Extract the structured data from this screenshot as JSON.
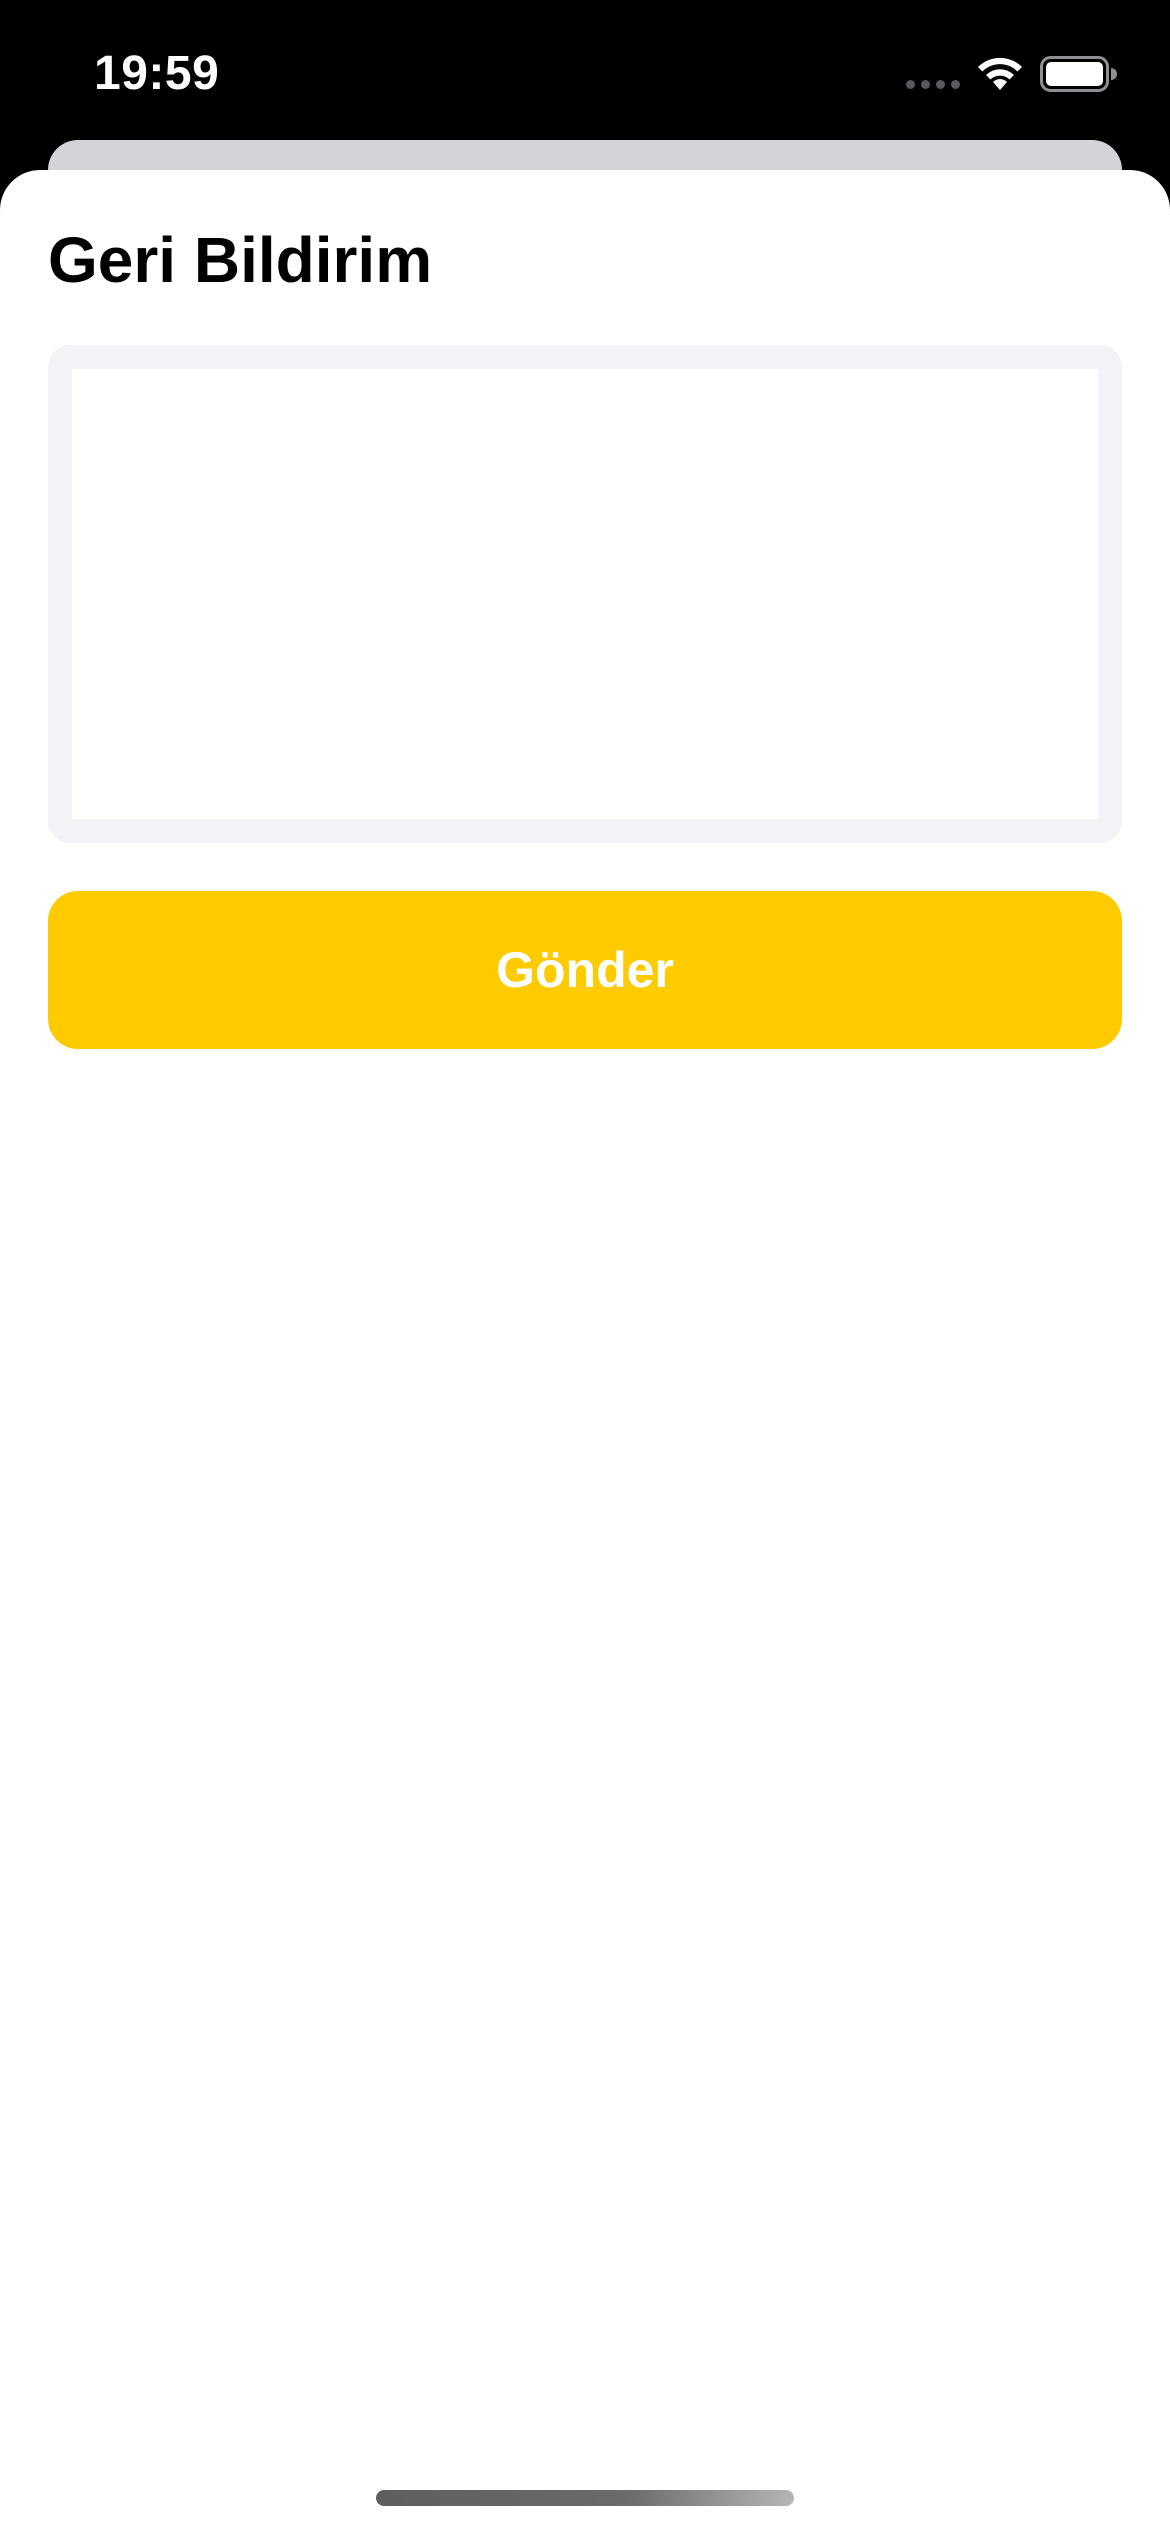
{
  "status_bar": {
    "time": "19:59",
    "icons": [
      "cellular-signal-icon",
      "wifi-icon",
      "battery-icon"
    ]
  },
  "sheet": {
    "title": "Geri Bildirim",
    "feedback_input": {
      "value": "",
      "placeholder": ""
    },
    "submit_label": "Gönder"
  },
  "colors": {
    "accent": "#fecb00",
    "input_border": "#f2f2f7",
    "background": "#ffffff",
    "status_bar_background": "#000000"
  }
}
